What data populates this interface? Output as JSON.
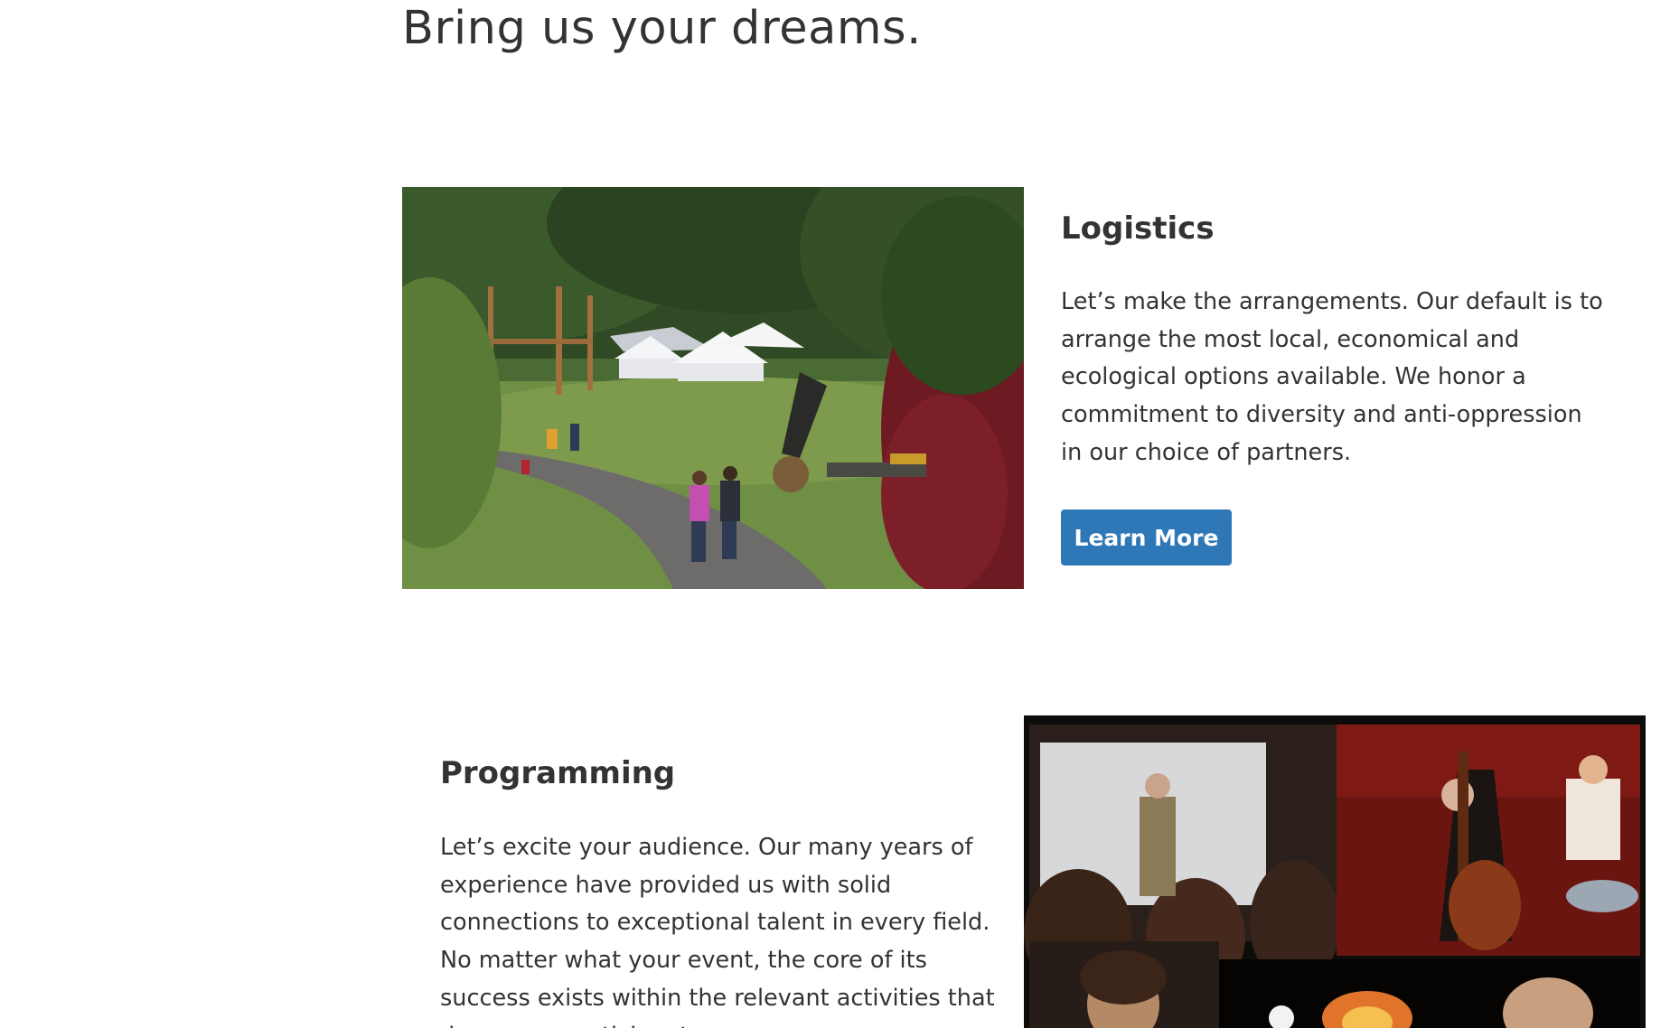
{
  "hero": {
    "headline": "Bring us your dreams."
  },
  "sections": [
    {
      "title": "Logistics",
      "body": "Let’s make the arrangements. Our default is to arrange the most local, economical and ecological options available. We honor a commitment to diversity and anti-oppression in our choice of partners.",
      "button_label": "Learn More",
      "image": "outdoor-event-field-photo"
    },
    {
      "title": "Programming",
      "body": "Let’s excite your audience. Our many years of experience have provided us with solid connections to exceptional talent in every field. No matter what your event, the core of its success exists within the relevant activities that draw your participants.",
      "image": "performers-collage-photo"
    }
  ],
  "colors": {
    "text": "#333333",
    "button_bg": "#2f78b7",
    "button_text": "#ffffff",
    "background": "#ffffff"
  }
}
